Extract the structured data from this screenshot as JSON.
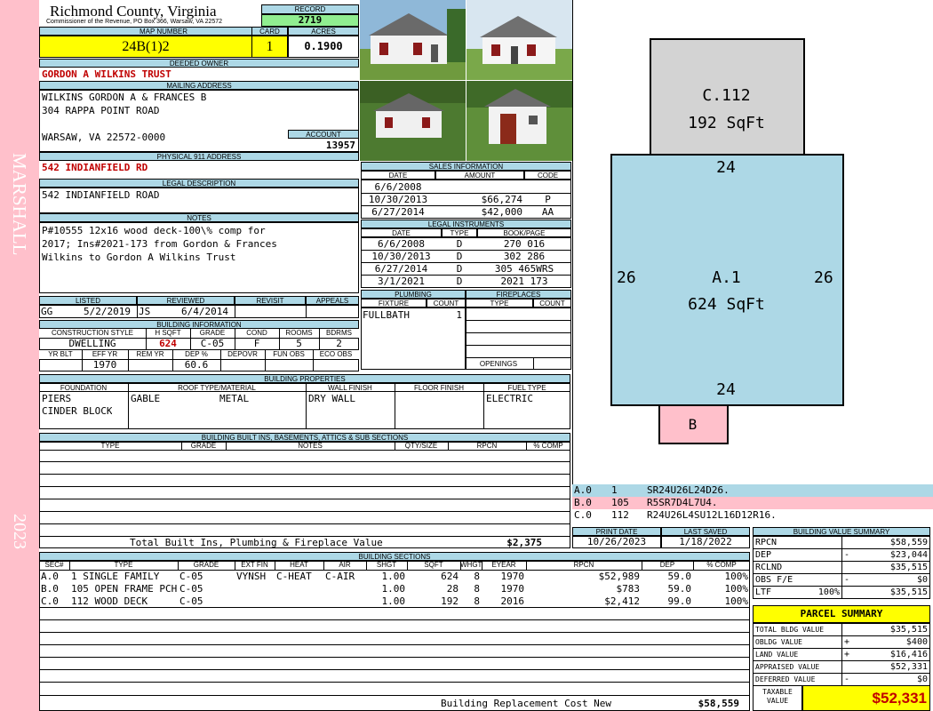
{
  "sidebar": {
    "district": "MARSHALL",
    "year": "2023"
  },
  "header": {
    "county": "Richmond County, Virginia",
    "commissioner": "Commissioner of the Revenue, PO Box 366, Warsaw, VA 22572"
  },
  "record": {
    "label": "RECORD",
    "value": "2719"
  },
  "map": {
    "label": "MAP NUMBER",
    "value": "24B(1)2",
    "card_label": "CARD",
    "card": "1",
    "acres_label": "ACRES",
    "acres": "0.1900"
  },
  "owner": {
    "label": "DEEDED OWNER",
    "value": "GORDON A WILKINS TRUST"
  },
  "mailing": {
    "label": "MAILING ADDRESS",
    "line1": "WILKINS GORDON A & FRANCES B",
    "line2": "304 RAPPA POINT ROAD",
    "line3": "WARSAW, VA 22572-0000"
  },
  "account": {
    "label": "ACCOUNT",
    "value": "13957"
  },
  "physical": {
    "label": "PHYSICAL 911 ADDRESS",
    "value": "542 INDIANFIELD RD"
  },
  "legal": {
    "label": "LEGAL DESCRIPTION",
    "value": "542 INDIANFIELD ROAD"
  },
  "notes": {
    "label": "NOTES",
    "line1": "P#10555 12x16 wood deck-100\\% comp for",
    "line2": "2017; Ins#2021-173 from Gordon & Frances",
    "line3": "Wilkins to Gordon A Wilkins Trust"
  },
  "review": {
    "listed_label": "LISTED",
    "reviewed_label": "REVIEWED",
    "revisit_label": "REVISIT",
    "appeals_label": "APPEALS",
    "listed_by": "GG",
    "listed_date": "5/2/2019",
    "reviewed_by": "JS",
    "reviewed_date": "6/4/2014"
  },
  "building_info": {
    "label": "BUILDING INFORMATION",
    "h_style": "CONSTRUCTION STYLE",
    "h_sqft": "H SQFT",
    "h_grade": "GRADE",
    "h_cond": "COND",
    "h_rooms": "ROOMS",
    "h_bdrms": "BDRMS",
    "style": "DWELLING",
    "sqft": "624",
    "grade": "C-05",
    "cond": "F",
    "rooms": "5",
    "bdrms": "2",
    "h_yrblt": "YR BLT",
    "h_effyr": "EFF YR",
    "h_remyr": "REM YR",
    "h_dep": "DEP %",
    "h_depovr": "DEPOVR",
    "h_funobs": "FUN OBS",
    "h_ecoobs": "ECO OBS",
    "effyr": "1970",
    "dep": "60.6"
  },
  "sales": {
    "label": "SALES INFORMATION",
    "h_date": "DATE",
    "h_amount": "AMOUNT",
    "h_code": "CODE",
    "rows": [
      {
        "date": "6/6/2008",
        "amount": "",
        "code": ""
      },
      {
        "date": "10/30/2013",
        "amount": "$66,274",
        "code": "P"
      },
      {
        "date": "6/27/2014",
        "amount": "$42,000",
        "code": "AA"
      }
    ]
  },
  "legal_instruments": {
    "label": "LEGAL INSTRUMENTS",
    "h_date": "DATE",
    "h_type": "TYPE",
    "h_book": "BOOK/PAGE",
    "rows": [
      {
        "date": "6/6/2008",
        "type": "D",
        "book": "270 016"
      },
      {
        "date": "10/30/2013",
        "type": "D",
        "book": "302 286"
      },
      {
        "date": "6/27/2014",
        "type": "D",
        "book": "305 465WRS"
      },
      {
        "date": "3/1/2021",
        "type": "D",
        "book": "2021 173"
      }
    ]
  },
  "plumbing": {
    "label": "PLUMBING",
    "h_fixture": "FIXTURE",
    "h_count": "COUNT",
    "fixture": "FULLBATH",
    "count": "1"
  },
  "fireplaces": {
    "label": "FIREPLACES",
    "h_type": "TYPE",
    "h_count": "COUNT",
    "openings": "OPENINGS"
  },
  "properties": {
    "label": "BUILDING PROPERTIES",
    "h_foundation": "FOUNDATION",
    "h_roof": "ROOF TYPE/MATERIAL",
    "h_wall": "WALL FINISH",
    "h_floor": "FLOOR FINISH",
    "h_fuel": "FUEL TYPE",
    "foundation1": "PIERS",
    "foundation2": "CINDER BLOCK",
    "roof_type": "GABLE",
    "roof_mat": "METAL",
    "wall": "DRY WALL",
    "floor": "",
    "fuel": "ELECTRIC"
  },
  "builtins": {
    "label": "BUILDING BUILT INS, BASEMENTS, ATTICS & SUB SECTIONS",
    "h_type": "TYPE",
    "h_grade": "GRADE",
    "h_notes": "NOTES",
    "h_qty": "QTY/SIZE",
    "h_rpcn": "RPCN",
    "h_comp": "% COMP",
    "total_label": "Total Built Ins, Plumbing & Fireplace Value",
    "total": "$2,375"
  },
  "sketch": {
    "c_label": "C.112",
    "c_area": "192 SqFt",
    "a_label": "A.1",
    "a_area": "624 SqFt",
    "b_label": "B",
    "top": "24",
    "bottom": "24",
    "left": "26",
    "right": "26",
    "legend": [
      {
        "code": "A.0",
        "num": "1",
        "path": "SR24U26L24D26."
      },
      {
        "code": "B.0",
        "num": "105",
        "path": "R5SR7D4L7U4."
      },
      {
        "code": "C.0",
        "num": "112",
        "path": "R24U26L4SU12L16D12R16."
      }
    ]
  },
  "dates": {
    "print_label": "PRINT DATE",
    "print": "10/26/2023",
    "saved_label": "LAST SAVED",
    "saved": "1/18/2022"
  },
  "sections": {
    "label": "BUILDING SECTIONS",
    "h": [
      "SEC#",
      "TYPE",
      "GRADE",
      "EXT FIN",
      "HEAT",
      "AIR",
      "SHGT",
      "SQFT",
      "WHGT",
      "EYEAR",
      "RPCN",
      "DEP",
      "% COMP"
    ],
    "rows": [
      [
        "A.0",
        "1 SINGLE FAMILY",
        "C-05",
        "VYNSH",
        "C-HEAT",
        "C-AIR",
        "1.00",
        "624",
        "8",
        "1970",
        "$52,989",
        "59.0",
        "100%"
      ],
      [
        "B.0",
        "105 OPEN FRAME PCH",
        "C-05",
        "",
        "",
        "",
        "1.00",
        "28",
        "8",
        "1970",
        "$783",
        "59.0",
        "100%"
      ],
      [
        "C.0",
        "112 WOOD DECK",
        "C-05",
        "",
        "",
        "",
        "1.00",
        "192",
        "8",
        "2016",
        "$2,412",
        "99.0",
        "100%"
      ]
    ],
    "rcn_label": "Building Replacement Cost New",
    "rcn": "$58,559"
  },
  "bvs": {
    "label": "BUILDING VALUE SUMMARY",
    "rpcn_l": "RPCN",
    "rpcn": "$58,559",
    "dep_l": "DEP",
    "dep_s": "-",
    "dep": "$23,044",
    "rclnd_l": "RCLND",
    "rclnd": "$35,515",
    "obs_l": "OBS F/E",
    "obs_s": "-",
    "obs": "$0",
    "ltr_l": "LTF",
    "ltr_p": "100%",
    "ltr": "$35,515"
  },
  "parcel": {
    "label": "PARCEL SUMMARY",
    "bldg_l": "TOTAL BLDG VALUE",
    "bldg": "$35,515",
    "obldg_l": "OBLDG VALUE",
    "obldg_s": "+",
    "obldg": "$400",
    "land_l": "LAND VALUE",
    "land_s": "+",
    "land": "$16,416",
    "appr_l": "APPRAISED VALUE",
    "appr": "$52,331",
    "def_l": "DEFERRED VALUE",
    "def_s": "-",
    "def": "$0",
    "tax_l1": "TAXABLE",
    "tax_l2": "VALUE",
    "tax": "$52,331"
  }
}
